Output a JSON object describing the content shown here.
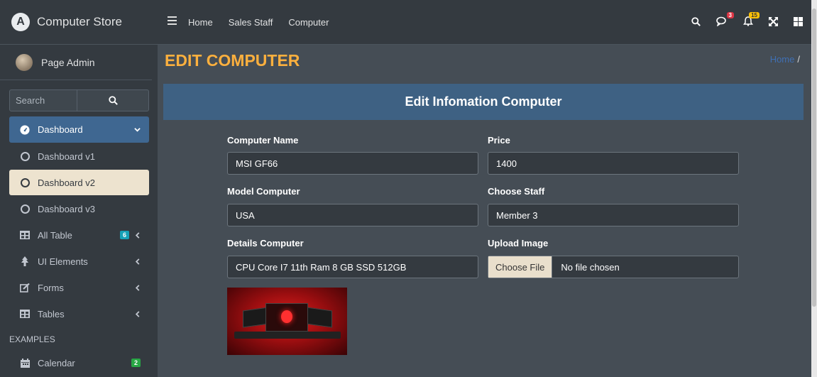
{
  "brand": {
    "name": "Computer Store"
  },
  "user": {
    "name": "Page Admin"
  },
  "search": {
    "placeholder": "Search"
  },
  "sidebar": {
    "dashboard": "Dashboard",
    "dashboard_v1": "Dashboard v1",
    "dashboard_v2": "Dashboard v2",
    "dashboard_v3": "Dashboard v3",
    "all_table": "All Table",
    "all_table_badge": "6",
    "ui_elements": "UI Elements",
    "forms": "Forms",
    "tables": "Tables",
    "examples_header": "EXAMPLES",
    "calendar": "Calendar",
    "calendar_badge": "2"
  },
  "topbar": {
    "links": [
      "Home",
      "Sales Staff",
      "Computer"
    ],
    "messages_badge": "3",
    "notifications_badge": "15"
  },
  "page": {
    "title": "EDIT COMPUTER",
    "breadcrumb_home": "Home",
    "breadcrumb_sep": "/"
  },
  "form": {
    "header": "Edit Infomation Computer",
    "computer_name_label": "Computer Name",
    "computer_name_value": "MSI GF66",
    "price_label": "Price",
    "price_value": "1400",
    "model_label": "Model Computer",
    "model_value": "USA",
    "staff_label": "Choose Staff",
    "staff_value": "Member 3",
    "details_label": "Details Computer",
    "details_value": "CPU Core I7 11th Ram 8 GB SSD 512GB",
    "upload_label": "Upload Image",
    "choose_file": "Choose File",
    "no_file": "No file chosen"
  },
  "colors": {
    "accent_title": "#fcb03e",
    "header_bg": "#3e6183",
    "active_nav": "#3f6791",
    "selected_nav": "#ede3cf"
  }
}
